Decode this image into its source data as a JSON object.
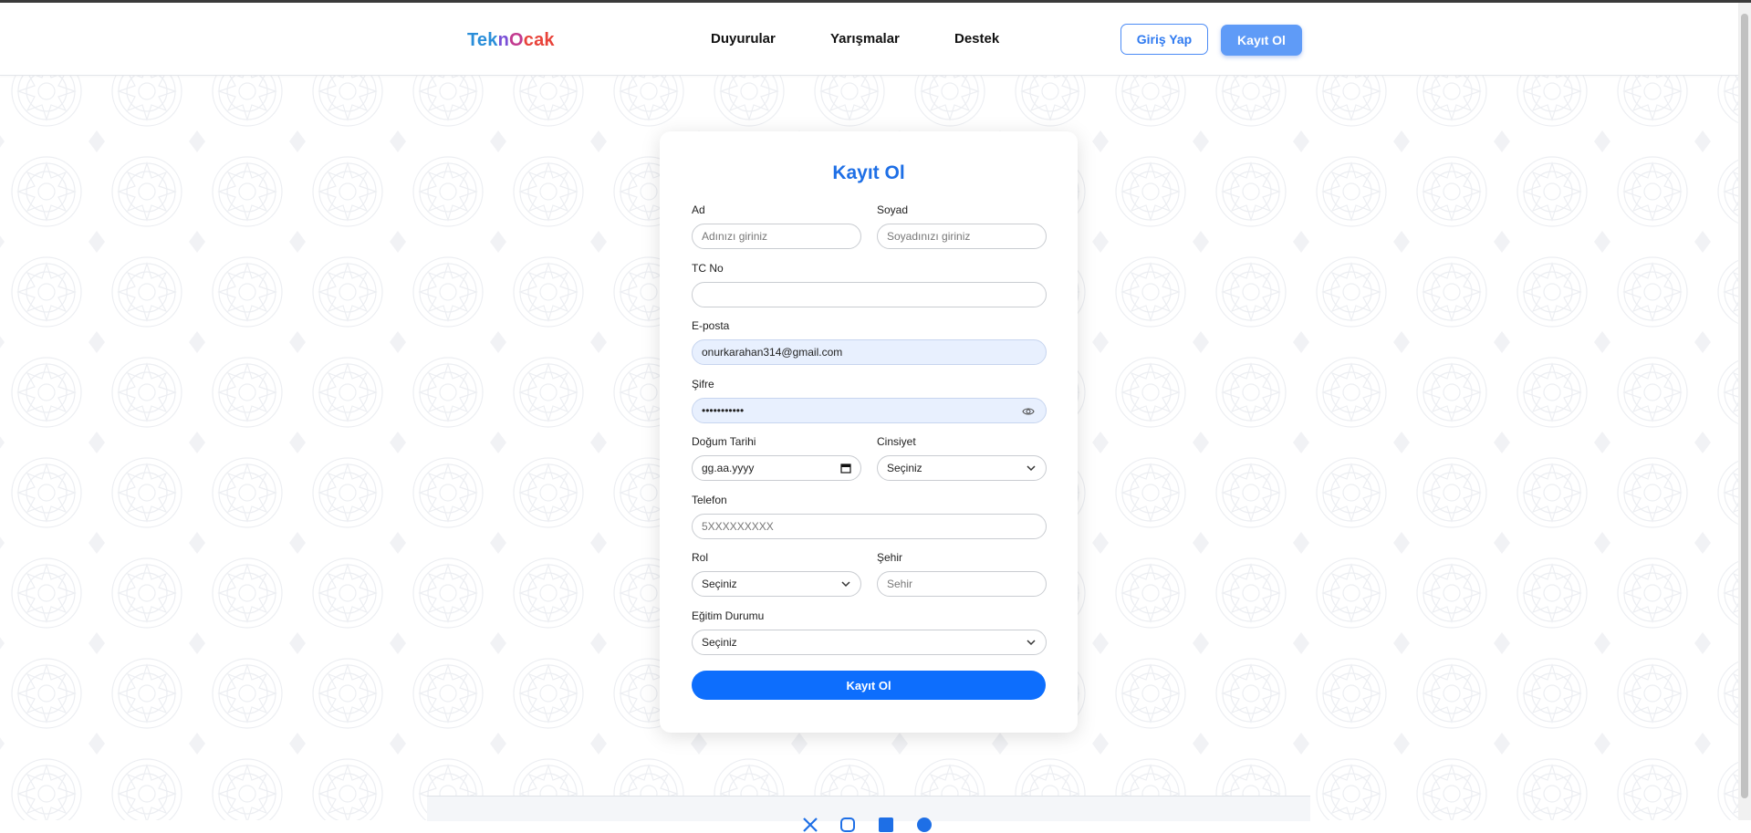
{
  "header": {
    "logo": {
      "part1": "Tek",
      "part2": "n",
      "part3": "O",
      "part4": "cak"
    },
    "nav": [
      "Duyurular",
      "Yarışmalar",
      "Destek"
    ],
    "login_label": "Giriş Yap",
    "register_label": "Kayıt Ol"
  },
  "form": {
    "title": "Kayıt Ol",
    "first_name": {
      "label": "Ad",
      "placeholder": "Adınızı giriniz"
    },
    "last_name": {
      "label": "Soyad",
      "placeholder": "Soyadınızı giriniz"
    },
    "tc": {
      "label": "TC No",
      "value": ""
    },
    "email": {
      "label": "E-posta",
      "value": "onurkarahan314@gmail.com"
    },
    "password": {
      "label": "Şifre",
      "value": "•••••••••••"
    },
    "birth_date": {
      "label": "Doğum Tarihi",
      "placeholder": "gg.aa.yyyy"
    },
    "gender": {
      "label": "Cinsiyet",
      "value": "Seçiniz"
    },
    "phone": {
      "label": "Telefon",
      "placeholder": "5XXXXXXXXX"
    },
    "role": {
      "label": "Rol",
      "value": "Seçiniz"
    },
    "city": {
      "label": "Şehir",
      "placeholder": "Sehir"
    },
    "education": {
      "label": "Eğitim Durumu",
      "value": "Seçiniz"
    },
    "submit_label": "Kayıt Ol"
  },
  "footer": {
    "icons": [
      "x-icon",
      "instagram-icon",
      "linkedin-icon",
      "globe-icon"
    ]
  },
  "colors": {
    "accent": "#0d6efd",
    "title": "#1e6fe6",
    "register_button": "#5f9bf7",
    "filled_field": "#e8f0fe"
  }
}
